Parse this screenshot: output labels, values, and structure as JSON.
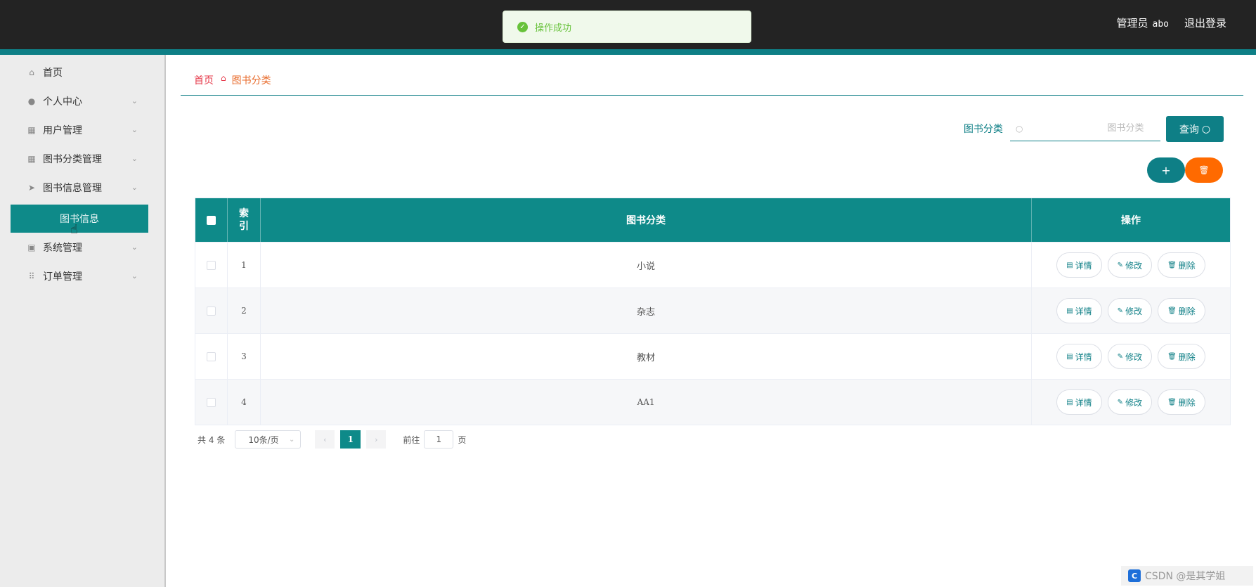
{
  "header": {
    "admin_label": "管理员",
    "admin_name": "abo",
    "logout": "退出登录"
  },
  "toast": {
    "icon": "check-circle-icon",
    "message": "操作成功"
  },
  "sidebar": {
    "items": [
      {
        "label": "首页",
        "icon": "home-icon"
      },
      {
        "label": "个人中心",
        "icon": "user-icon"
      },
      {
        "label": "用户管理",
        "icon": "grid-icon"
      },
      {
        "label": "图书分类管理",
        "icon": "grid-icon"
      },
      {
        "label": "图书信息管理",
        "icon": "send-icon"
      },
      {
        "label": "系统管理",
        "icon": "clipboard-icon"
      },
      {
        "label": "订单管理",
        "icon": "apps-icon"
      }
    ],
    "active_sub": "图书信息"
  },
  "breadcrumb": {
    "home": "首页",
    "current": "图书分类"
  },
  "search": {
    "label": "图书分类",
    "placeholder": "图书分类",
    "button": "查询"
  },
  "table": {
    "headers": {
      "index": "索\n引",
      "category": "图书分类",
      "ops": "操作"
    },
    "rows": [
      {
        "index": "1",
        "category": "小说"
      },
      {
        "index": "2",
        "category": "杂志"
      },
      {
        "index": "3",
        "category": "教材"
      },
      {
        "index": "4",
        "category": "AA1"
      }
    ],
    "op_labels": {
      "detail": "详情",
      "edit": "修改",
      "delete": "删除"
    }
  },
  "pagination": {
    "total_prefix": "共",
    "total": "4",
    "total_suffix": "条",
    "page_size": "10条/页",
    "current_page": "1",
    "goto_prefix": "前往",
    "goto_value": "1",
    "goto_suffix": "页"
  },
  "watermark": "CSDN @是其学姐",
  "colors": {
    "accent": "#0e7f86",
    "danger": "#ff6a00",
    "success": "#67c23a",
    "topbar": "#232323"
  }
}
